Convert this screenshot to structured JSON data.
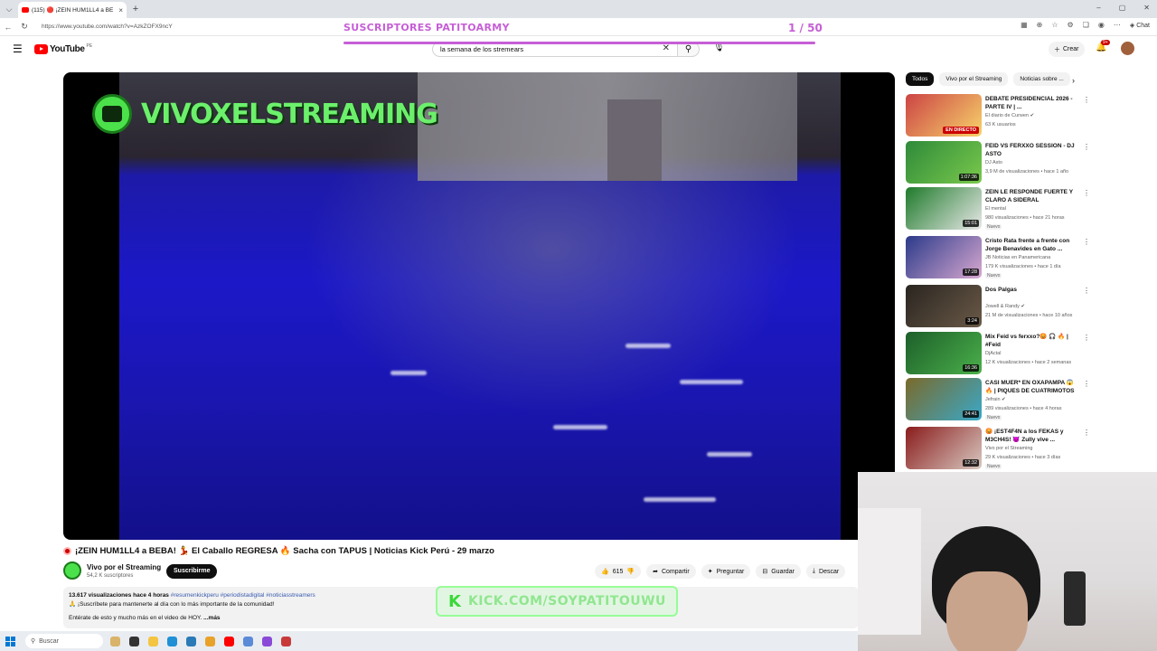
{
  "browser": {
    "tab_title": "(115) 🔴 ¡ZEIN HUM1LL4 a BE",
    "url": "https://www.youtube.com/watch?v=AzkZOFX9ncY",
    "chat_label": "Chat"
  },
  "overlay": {
    "title": "SUSCRIPTORES PATITOARMY",
    "count": "1 / 50",
    "kick_url": "KICK.COM/SOYPATITOUWU",
    "brand_text": "VIVOXELSTREAMING"
  },
  "header": {
    "logo_text": "YouTube",
    "country": "PE",
    "search_value": "la semana de los stremears",
    "create_label": "Crear",
    "notif_badge": "9+"
  },
  "video": {
    "title": "¡ZEIN HUM1LL4 a BEBA! 💃 El Caballo REGRESA 🔥 Sacha con TAPUS | Noticias Kick Perú - 29 marzo",
    "channel": "Vivo por el Streaming",
    "subscribers": "54,2 K suscriptores",
    "subscribe_label": "Suscribirme",
    "likes": "615",
    "share_label": "Compartir",
    "ask_label": "Preguntar",
    "save_label": "Guardar",
    "download_label": "Descar",
    "views_time": "13.617 visualizaciones  hace 4 horas",
    "hashtags": "#resumenkickperu #periodistadigital #noticiasstreamers",
    "desc_line1": "🙏 ¡Suscríbete para mantenerte al día con lo más importante de la comunidad!",
    "desc_line2": "Entérate de esto y mucho más en el video de HOY.",
    "more_label": "...más"
  },
  "chips": [
    "Todos",
    "Vivo por el Streaming",
    "Noticias sobre ..."
  ],
  "recommendations": [
    {
      "title": "DEBATE PRESIDENCIAL 2026 - PARTE IV | ...",
      "channel": "El diario de Curwen ✔",
      "views": "63 K usuarios",
      "badge": "EN DIRECTO",
      "new": "",
      "colors": [
        "#c44",
        "#f7d36b"
      ]
    },
    {
      "title": "FEID VS FERXXO SESSION - DJ ASTO",
      "channel": "DJ Asto",
      "views": "3,9 M de visualizaciones • hace 1 año",
      "badge": "1:07:36",
      "new": "",
      "colors": [
        "#2f8a3a",
        "#79c94b"
      ]
    },
    {
      "title": "ZEIN LE RESPONDE FUERTE Y CLARO A SIDERAL",
      "channel": "El mental",
      "views": "980 visualizaciones • hace 21 horas",
      "badge": "15:01",
      "new": "Nuevo",
      "colors": [
        "#1e7a2a",
        "#e8e8e8"
      ]
    },
    {
      "title": "Cristo Rata frente a frente con Jorge Benavides en Gato ...",
      "channel": "JB Noticias en Panamericana",
      "views": "179 K visualizaciones • hace 1 día",
      "badge": "17:28",
      "new": "Nuevo",
      "colors": [
        "#2b3a8a",
        "#d8a8d0"
      ]
    },
    {
      "title": "Dos Palgas",
      "channel": "Jowell & Randy ✔",
      "views": "21 M de visualizaciones • hace 10 años",
      "badge": "3:24",
      "new": "",
      "colors": [
        "#2a2520",
        "#6a5a48"
      ]
    },
    {
      "title": "Mix Feid vs ferxxo?😡 🎧 🔥 | #Feid",
      "channel": "DjActal",
      "views": "12 K visualizaciones • hace 2 semanas",
      "badge": "16:36",
      "new": "",
      "colors": [
        "#1d5f2a",
        "#4ab04a"
      ]
    },
    {
      "title": "CASI MUER* EN OXAPAMPA 😱 🔥 | PIQUES DE CUATRIMOTOS",
      "channel": "Jefrain ✔",
      "views": "289 visualizaciones • hace 4 horas",
      "badge": "24:41",
      "new": "Nuevo",
      "colors": [
        "#7a6a2a",
        "#3aa8c8"
      ]
    },
    {
      "title": "😡 ¡EST4F4N a los FEKAS y M3CH4S! 😈 Zully vive ...",
      "channel": "Vivo por el Streaming",
      "views": "29 K visualizaciones • hace 3 días",
      "badge": "12:32",
      "new": "Nuevo",
      "colors": [
        "#8a1c1c",
        "#d8c8c0"
      ]
    }
  ],
  "taskbar": {
    "search_label": "Buscar"
  },
  "colors": {
    "accent": "#ff0000",
    "overlay_purple": "#c65fd6",
    "kick_green": "#3ad83a",
    "pool_blue": "#1c18c8"
  }
}
